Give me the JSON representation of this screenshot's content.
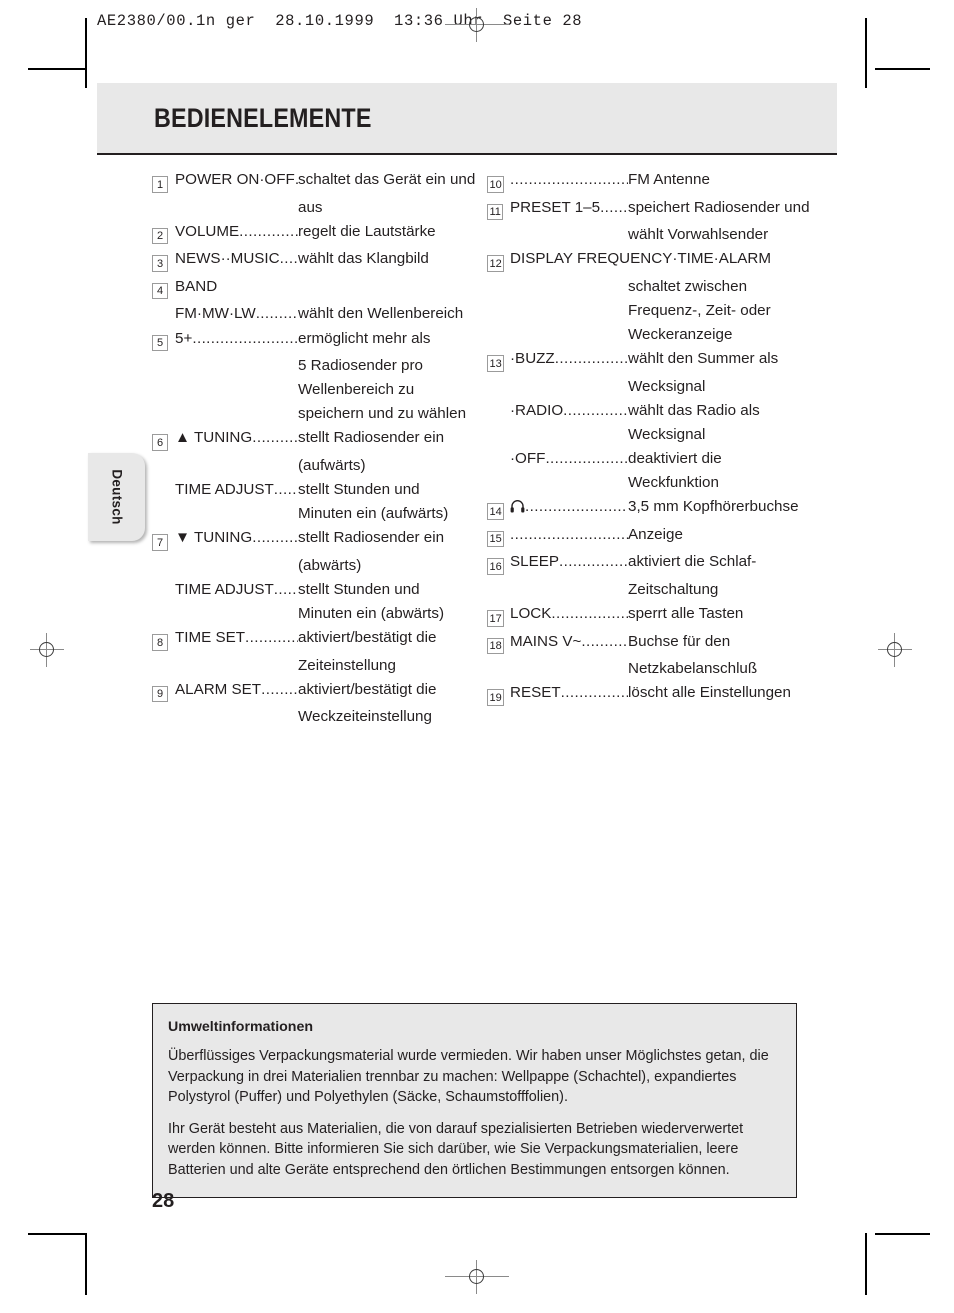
{
  "print_header": "AE2380/00.1n ger  28.10.1999  13:36 Uhr  Seite 28",
  "title": "BEDIENELEMENTE",
  "language_tab": "Deutsch",
  "page_number": "28",
  "leader": "...................................",
  "left_column": [
    {
      "num": "1",
      "term": "POWER ON·OFF",
      "leader": "...",
      "def": "schaltet das Gerät ein und",
      "cont": [
        "aus"
      ]
    },
    {
      "num": "2",
      "term": "VOLUME",
      "leader": "...............",
      "def": "regelt die Lautstärke",
      "cont": []
    },
    {
      "num": "3",
      "term": "NEWS··MUSIC",
      "leader": ".....",
      "def": "wählt das Klangbild",
      "cont": []
    },
    {
      "num": "4",
      "term": "BAND",
      "leader": "",
      "def": "",
      "cont": [],
      "second_term": "FM·MW·LW",
      "second_leader": "..........",
      "second_def": "wählt den Wellenbereich"
    },
    {
      "num": "5",
      "term": "5+",
      "leader": "........................",
      "def": "ermöglicht mehr als",
      "cont": [
        "5 Radiosender pro",
        "Wellenbereich zu",
        "speichern und zu wählen"
      ]
    },
    {
      "num": "6",
      "term_icon": "triangle-up-icon",
      "term": "▲ TUNING",
      "leader": "...........",
      "def": "stellt Radiosender ein",
      "cont": [
        "(aufwärts)"
      ],
      "sub": [
        {
          "term": "TIME ADJUST",
          "leader": "......",
          "def": "stellt Stunden und",
          "cont": [
            "Minuten ein (aufwärts)"
          ]
        }
      ]
    },
    {
      "num": "7",
      "term_icon": "triangle-down-icon",
      "term": "▼ TUNING",
      "leader": "...........",
      "def": "stellt Radiosender ein",
      "cont": [
        "(abwärts)"
      ],
      "sub": [
        {
          "term": "TIME ADJUST",
          "leader": "......",
          "def": "stellt Stunden und",
          "cont": [
            "Minuten ein (abwärts)"
          ]
        }
      ]
    },
    {
      "num": "8",
      "term": "TIME SET",
      "leader": ".............",
      "def": "aktiviert/bestätigt die",
      "cont": [
        "Zeiteinstellung"
      ]
    },
    {
      "num": "9",
      "term": "ALARM SET",
      "leader": "..........",
      "def": "aktiviert/bestätigt die",
      "cont": [
        "Weckzeiteinstellung"
      ]
    }
  ],
  "right_column": [
    {
      "num": "10",
      "term": "",
      "leader": "............................",
      "def": "FM Antenne",
      "cont": []
    },
    {
      "num": "11",
      "term": "PRESET 1–5",
      "leader": ".........",
      "def": "speichert Radiosender und",
      "cont": [
        "wählt Vorwahlsender"
      ]
    },
    {
      "num": "12",
      "term": "DISPLAY FREQUENCY·TIME·ALARM",
      "leader": "",
      "def": "",
      "cont": [
        "schaltet zwischen",
        "Frequenz-, Zeit- oder",
        "Weckeranzeige"
      ],
      "term_full_width": true
    },
    {
      "num": "13",
      "term": "·BUZZ",
      "leader": "...................",
      "def": "wählt den Summer als",
      "cont": [
        "Wecksignal"
      ],
      "sub": [
        {
          "term": "·RADIO",
          "leader": ".................",
          "def": "wählt das Radio als",
          "cont": [
            "Wecksignal"
          ]
        },
        {
          "term": "·OFF",
          "leader": ".....................",
          "def": "deaktiviert die",
          "cont": [
            "Weckfunktion"
          ]
        }
      ]
    },
    {
      "num": "14",
      "term_icon": "headphone-icon",
      "term": "",
      "leader": ".........................",
      "def": "3,5 mm Kopfhörerbuchse",
      "cont": []
    },
    {
      "num": "15",
      "term": "",
      "leader": "............................",
      "def": "Anzeige",
      "cont": []
    },
    {
      "num": "16",
      "term": "SLEEP",
      "leader": "...................",
      "def": "aktiviert die Schlaf-",
      "cont": [
        "Zeitschaltung"
      ]
    },
    {
      "num": "17",
      "term": "LOCK",
      "leader": "....................",
      "def": "sperrt alle Tasten",
      "cont": []
    },
    {
      "num": "18",
      "term": "MAINS V~",
      "leader": "...........",
      "def": "Buchse für den",
      "cont": [
        "Netzkabelanschluß"
      ]
    },
    {
      "num": "19",
      "term": "RESET",
      "leader": "..................",
      "def": "löscht alle Einstellungen",
      "cont": []
    }
  ],
  "info_box": {
    "title": "Umweltinformationen",
    "paragraphs": [
      "Überflüssiges Verpackungsmaterial wurde vermieden. Wir haben unser Möglichstes getan, die Verpackung in drei Materialien trennbar zu machen: Wellpappe (Schachtel), expandiertes Polystyrol (Puffer) und Polyethylen (Säcke, Schaumstofffolien).",
      "Ihr Gerät besteht aus Materialien, die von darauf spezialisierten Betrieben wiederverwertet werden können. Bitte informieren Sie sich darüber, wie Sie Verpackungsmaterialien, leere Batterien und alte Geräte entsprechend den örtlichen Bestimmungen entsorgen können."
    ]
  },
  "colors": {
    "band_gray": "#e8e8e8",
    "ink": "#231f20"
  }
}
